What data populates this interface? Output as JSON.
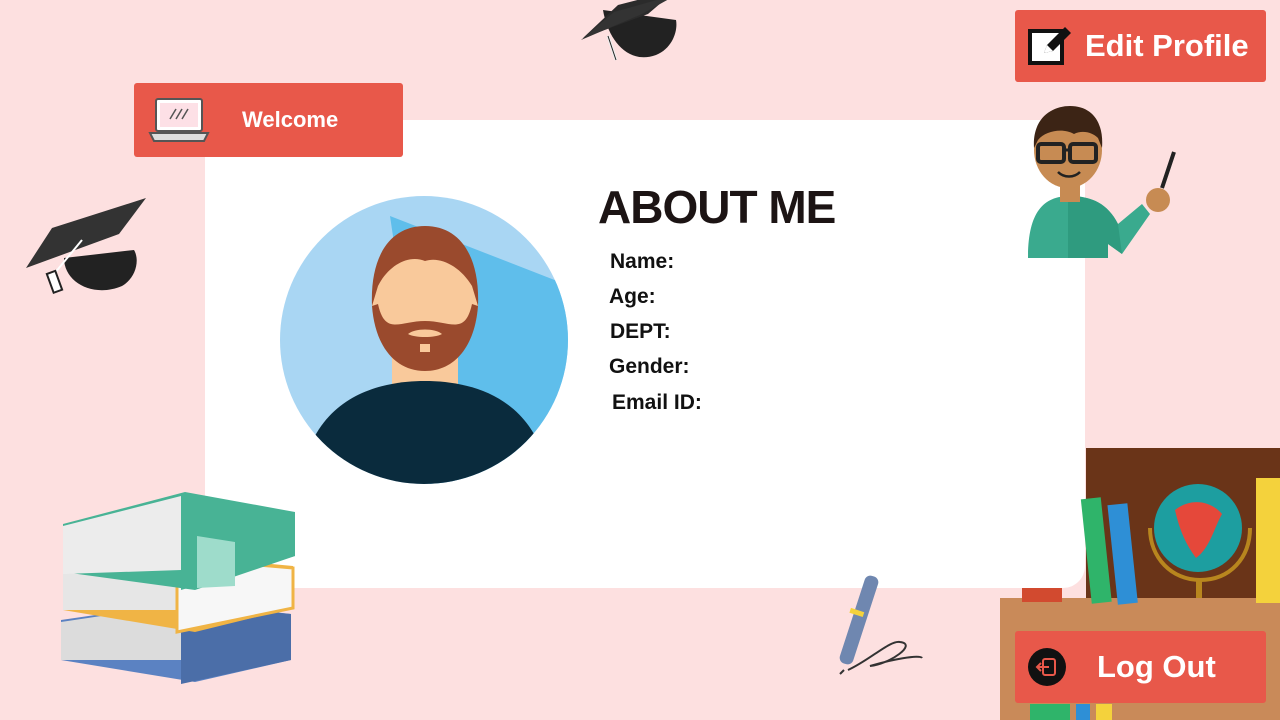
{
  "header": {
    "welcome_label": "Welcome",
    "edit_profile_label": "Edit Profile"
  },
  "profile": {
    "title": "ABOUT ME",
    "fields": [
      {
        "label": "Name:"
      },
      {
        "label": "Age:"
      },
      {
        "label": "DEPT:"
      },
      {
        "label": "Gender:"
      },
      {
        "label": "Email ID:"
      }
    ]
  },
  "footer": {
    "logout_label": "Log Out"
  },
  "icons": {
    "welcome": "laptop-icon",
    "edit": "edit-icon",
    "logout": "logout-icon",
    "avatar": "avatar",
    "decor": [
      "graduation-cap-icon",
      "teacher-illustration",
      "books-stack-illustration",
      "pen-icon",
      "bookshelf-illustration"
    ]
  },
  "colors": {
    "background": "#fde0e0",
    "accent": "#e8584a",
    "card": "#ffffff",
    "avatar_bg": "#a9d6f3"
  }
}
